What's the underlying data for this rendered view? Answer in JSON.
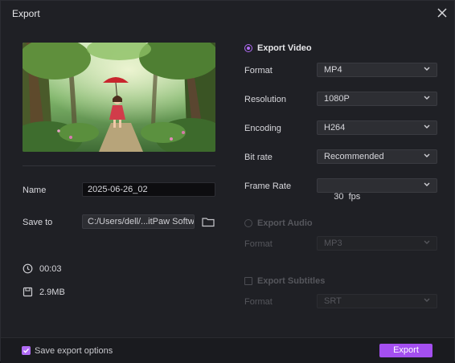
{
  "window": {
    "title": "Export"
  },
  "left": {
    "name_label": "Name",
    "name_value": "2025-06-26_02",
    "saveto_label": "Save to",
    "saveto_value": "C:/Users/dell/...itPaw Software",
    "duration": "00:03",
    "filesize": "2.9MB"
  },
  "export_video": {
    "label": "Export Video",
    "rows": [
      {
        "label": "Format",
        "value": "MP4"
      },
      {
        "label": "Resolution",
        "value": "1080P"
      },
      {
        "label": "Encoding",
        "value": "H264"
      },
      {
        "label": "Bit rate",
        "value": "Recommended"
      },
      {
        "label": "Frame Rate",
        "value": "30  fps"
      }
    ]
  },
  "export_audio": {
    "label": "Export Audio",
    "format_label": "Format",
    "format_value": "MP3"
  },
  "export_subtitles": {
    "label": "Export Subtitles",
    "format_label": "Format",
    "format_value": "SRT"
  },
  "footer": {
    "save_options_label": "Save export options",
    "export_button": "Export"
  },
  "colors": {
    "accent": "#a44ff0",
    "background": "#1f2025"
  }
}
